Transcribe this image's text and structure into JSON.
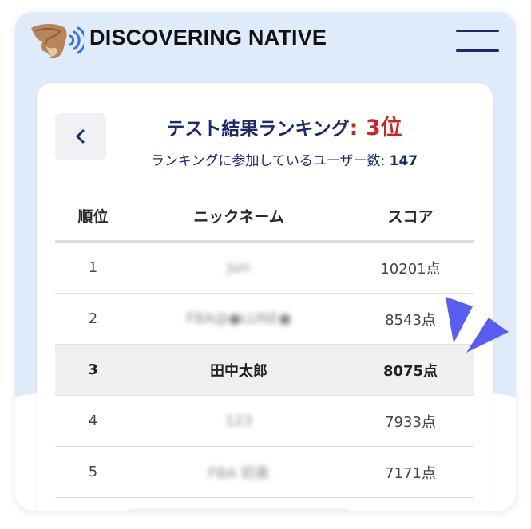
{
  "header": {
    "brand": "DISCOVERING NATIVE",
    "logo_icon": "speaking-head-icon",
    "menu_icon": "hamburger-menu-icon"
  },
  "ranking": {
    "back_icon": "chevron-left-icon",
    "title": "テスト結果ランキング",
    "rank_text": ": 3位",
    "participants_label": "ランキングに参加しているユーザー数: ",
    "participants_count": "147"
  },
  "table": {
    "headers": {
      "rank": "順位",
      "nickname": "ニックネーム",
      "score": "スコア"
    },
    "rows": [
      {
        "rank": "1",
        "nickname": "Jun",
        "score": "10201点"
      },
      {
        "rank": "2",
        "nickname": "FBA@●LUNE●",
        "score": "8543点"
      },
      {
        "rank": "3",
        "nickname": "田中太郎",
        "score": "8075点"
      },
      {
        "rank": "4",
        "nickname": "123",
        "score": "7933点"
      },
      {
        "rank": "5",
        "nickname": "FBA 初奥",
        "score": "7171点"
      }
    ]
  },
  "colors": {
    "navy": "#1b2a6b",
    "rank_red": "#c62828",
    "accent_blue": "#5a5ef0",
    "page_blue": "#dfeafb"
  }
}
